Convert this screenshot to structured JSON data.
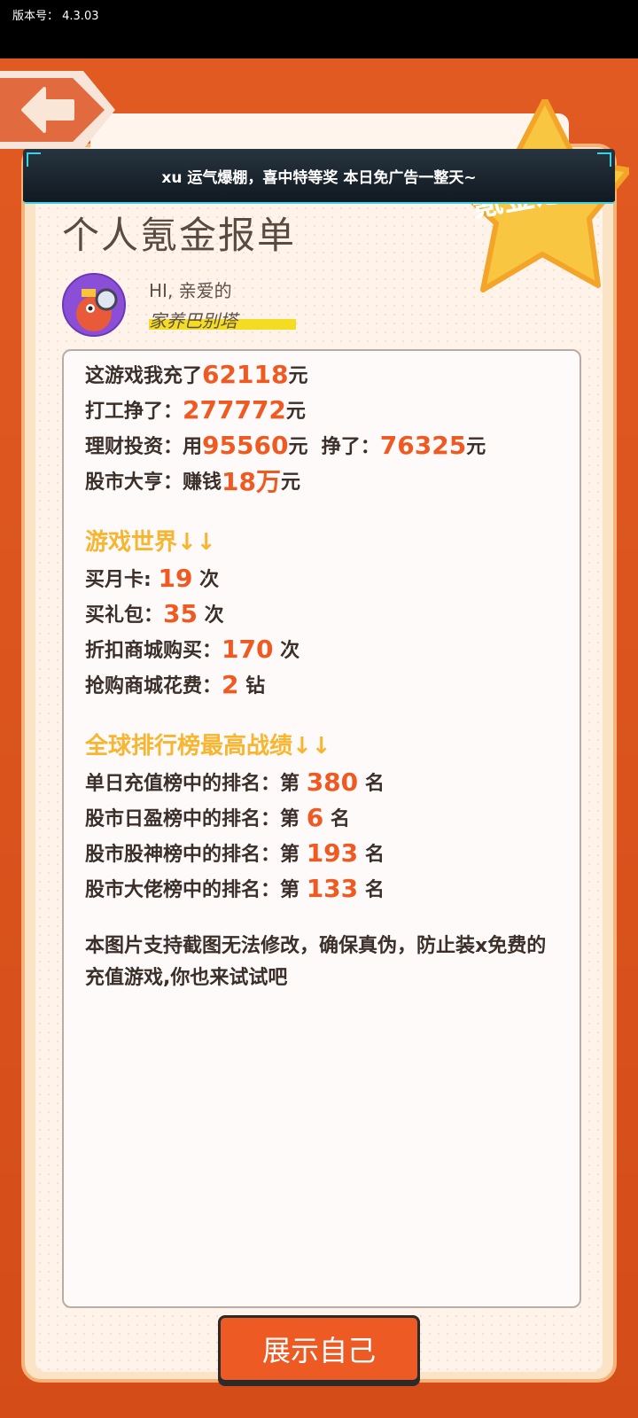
{
  "status_bar": {
    "version_label": "版本号：  4.3.03"
  },
  "banner": {
    "text": "xu 运气爆棚，喜中特等奖 本日免广告一整天~"
  },
  "badge": {
    "text": "氪金之王"
  },
  "page": {
    "title": "个人氪金报单"
  },
  "profile": {
    "greeting": "HI, 亲爱的",
    "nickname": "家养巴别塔"
  },
  "report": {
    "spend": {
      "label": "这游戏我充了",
      "value": "62118",
      "unit": "元"
    },
    "work": {
      "label": "打工挣了：",
      "value": "277772",
      "unit": "元"
    },
    "invest": {
      "label": "理财投资：用",
      "used": "95560",
      "mid": "元  挣了：",
      "earned": "76325",
      "unit": "元"
    },
    "stock": {
      "label": "股市大亨：赚钱",
      "value": "18万",
      "unit": "元"
    },
    "world_title": "游戏世界↓↓",
    "monthly": {
      "label": "买月卡:",
      "value": "19",
      "unit": "次"
    },
    "gift": {
      "label": "买礼包：",
      "value": "35",
      "unit": "次"
    },
    "discount": {
      "label": "折扣商城购买：",
      "value": "170",
      "unit": "次"
    },
    "flash": {
      "label": "抢购商城花费：",
      "value": "2",
      "unit": "钻"
    },
    "rank_title": "全球排行榜最高战绩↓↓",
    "rank_daily": {
      "label": "单日充值榜中的排名：第",
      "value": "380",
      "unit": "名"
    },
    "rank_profit": {
      "label": "股市日盈榜中的排名：第",
      "value": "6",
      "unit": "名"
    },
    "rank_god": {
      "label": "股市股神榜中的排名：第",
      "value": "193",
      "unit": "名"
    },
    "rank_boss": {
      "label": "股市大佬榜中的排名：第",
      "value": "133",
      "unit": "名"
    },
    "note": "本图片支持截图无法修改，确保真伪，防止装x免费的充值游戏,你也来试试吧"
  },
  "actions": {
    "show_label": "展示自己"
  }
}
